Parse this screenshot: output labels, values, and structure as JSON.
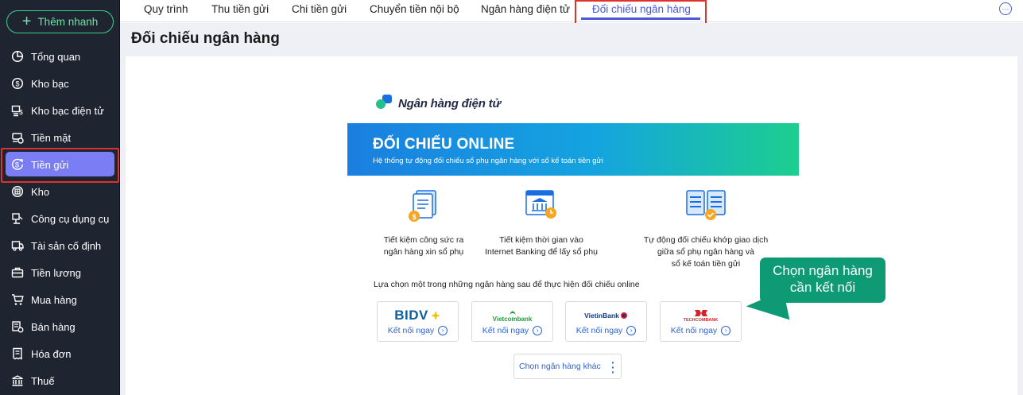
{
  "sidebar": {
    "quick_add_label": "Thêm nhanh",
    "items": [
      {
        "label": "Tổng quan",
        "icon": "pie-chart-icon"
      },
      {
        "label": "Kho bạc",
        "icon": "dollar-coin-icon"
      },
      {
        "label": "Kho bạc điện tử",
        "icon": "e-treasury-icon"
      },
      {
        "label": "Tiền mặt",
        "icon": "cash-icon"
      },
      {
        "label": "Tiền gửi",
        "icon": "deposit-icon",
        "active": true
      },
      {
        "label": "Kho",
        "icon": "warehouse-icon"
      },
      {
        "label": "Công cụ dụng cụ",
        "icon": "tools-icon"
      },
      {
        "label": "Tài sản cố định",
        "icon": "truck-icon"
      },
      {
        "label": "Tiền lương",
        "icon": "briefcase-icon"
      },
      {
        "label": "Mua hàng",
        "icon": "cart-icon"
      },
      {
        "label": "Bán hàng",
        "icon": "sales-icon"
      },
      {
        "label": "Hóa đơn",
        "icon": "invoice-icon"
      },
      {
        "label": "Thuế",
        "icon": "bank-building-icon"
      }
    ]
  },
  "tabs": [
    {
      "label": "Quy trình"
    },
    {
      "label": "Thu tiền gửi"
    },
    {
      "label": "Chi tiền gửi"
    },
    {
      "label": "Chuyển tiền nội bộ"
    },
    {
      "label": "Ngân hàng điện tử"
    },
    {
      "label": "Đối chiếu ngân hàng",
      "active": true
    }
  ],
  "page": {
    "title": "Đối chiếu ngân hàng",
    "brand": "Ngân hàng điện tử",
    "banner_title": "ĐỐI CHIẾU ONLINE",
    "banner_subtitle": "Hệ thống tự động đối chiếu sổ phụ ngân hàng với sổ kế toán tiền gửi",
    "features": [
      {
        "line1": "Tiết kiệm công sức ra",
        "line2": "ngân hàng xin sổ phụ",
        "line3": ""
      },
      {
        "line1": "Tiết kiệm thời gian vào",
        "line2": "Internet Banking để lấy sổ phụ",
        "line3": ""
      },
      {
        "line1": "Tự động đối chiếu khớp giao dịch",
        "line2": "giữa sổ phụ ngân hàng và",
        "line3": "sổ kế toán tiền gửi"
      }
    ],
    "choose_text": "Lựa chọn một trong những ngân hàng sau để thực hiện đối chiếu online",
    "banks": [
      {
        "name": "BIDV",
        "connect": "Kết nối ngay"
      },
      {
        "name": "Vietcombank",
        "connect": "Kết nối ngay"
      },
      {
        "name": "VietinBank",
        "connect": "Kết nối ngay"
      },
      {
        "name": "TECHCOMBANK",
        "connect": "Kết nối ngay"
      }
    ],
    "other_bank": "Chọn ngân hàng khác",
    "callout_line1": "Chọn ngân hàng",
    "callout_line2": "cần kết nối"
  },
  "colors": {
    "sidebar_bg": "#1f2431",
    "active_pill": "#7a7df3",
    "accent": "#4a57d6",
    "highlight": "#e0312f",
    "callout": "#0f9a76"
  }
}
